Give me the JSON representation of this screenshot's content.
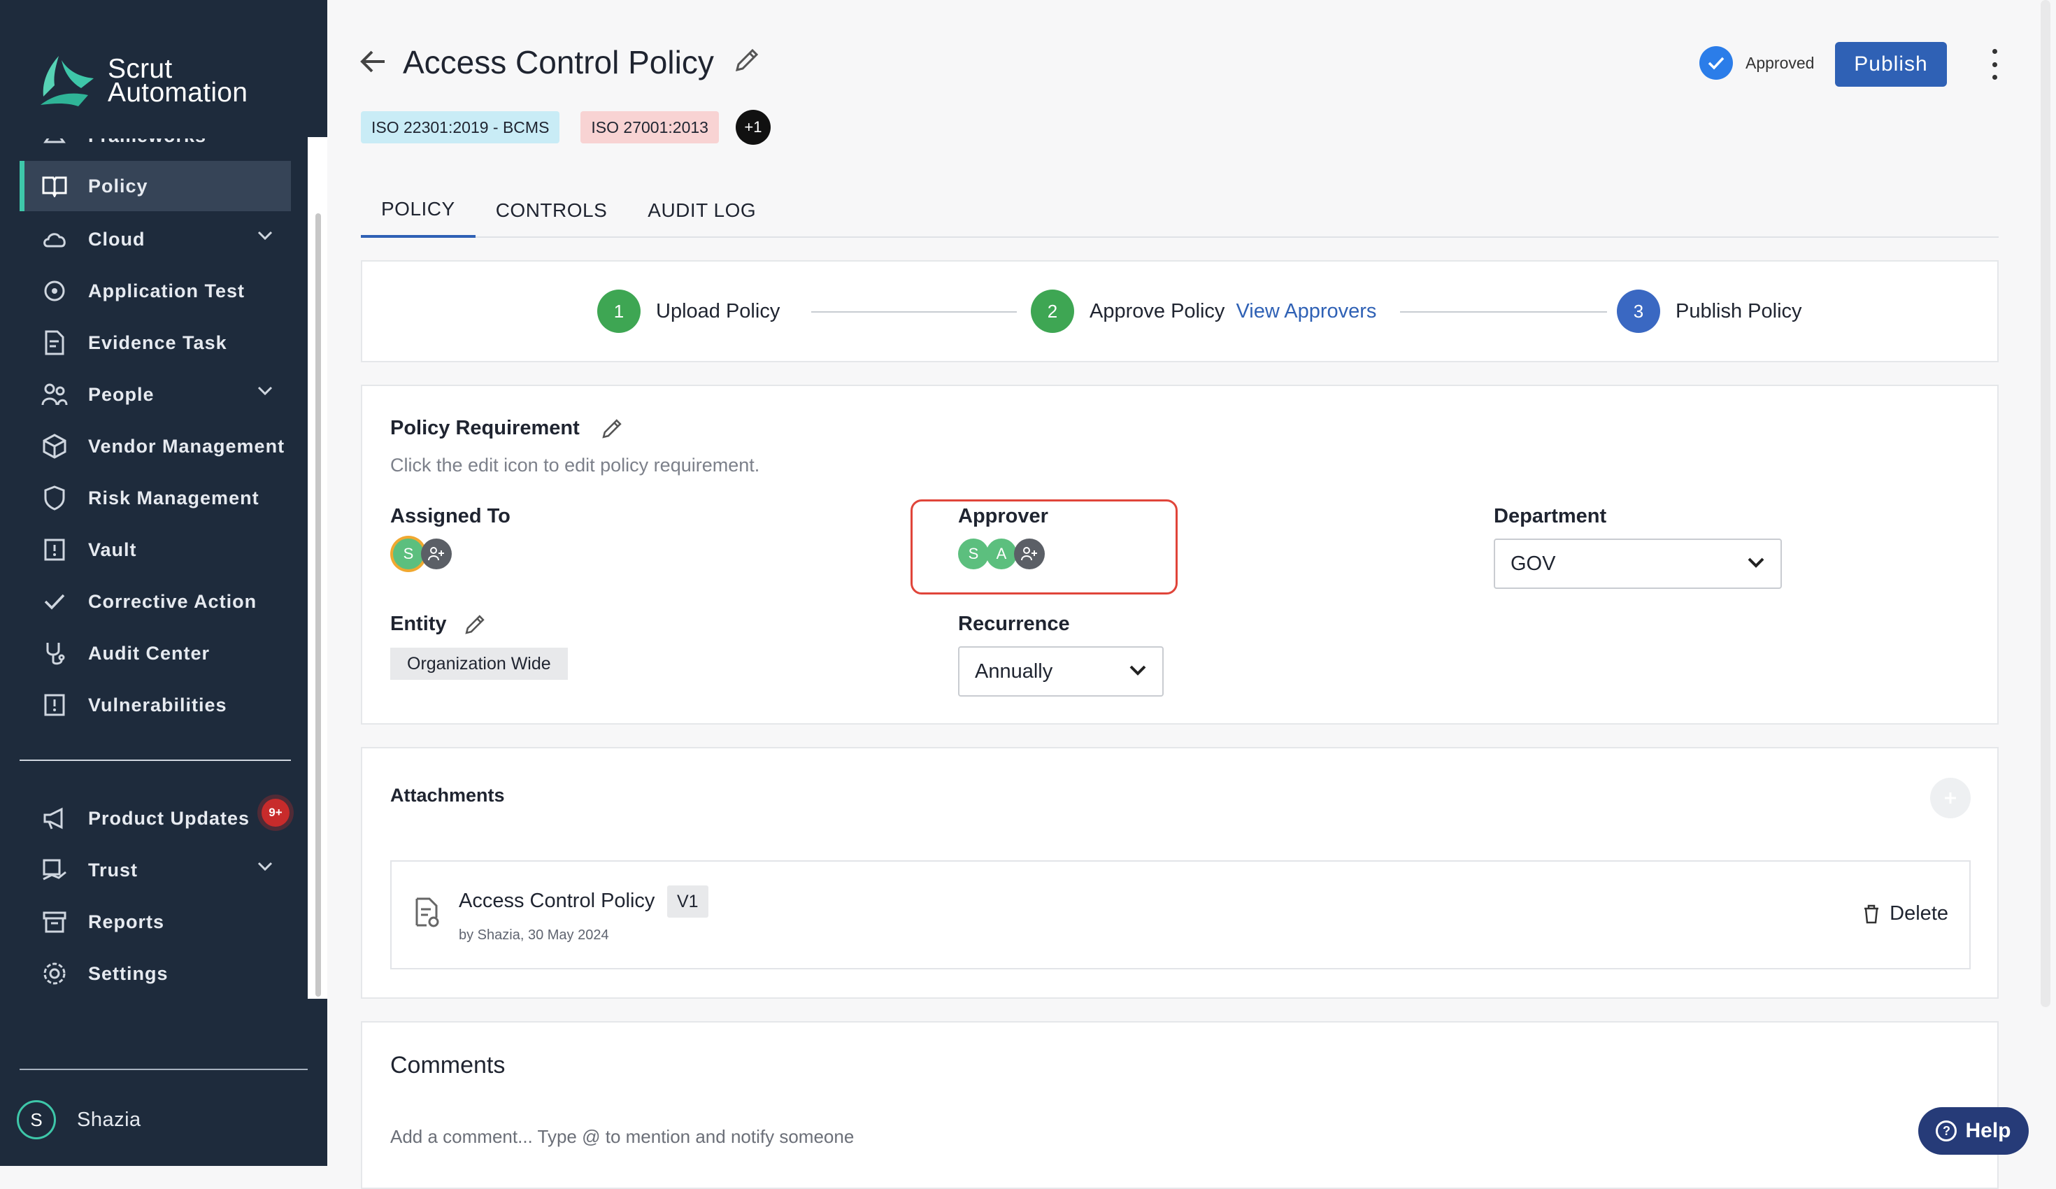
{
  "brand": {
    "line1": "Scrut",
    "line2": "Automation",
    "accent": "#3ec7a9"
  },
  "sidebar": {
    "items": [
      {
        "label": "Frameworks",
        "icon": "frameworks-icon"
      },
      {
        "label": "Policy",
        "icon": "book-icon",
        "active": true
      },
      {
        "label": "Cloud",
        "icon": "cloud-icon",
        "has_children": true
      },
      {
        "label": "Application Test",
        "icon": "app-test-icon"
      },
      {
        "label": "Evidence Task",
        "icon": "evidence-icon"
      },
      {
        "label": "People",
        "icon": "people-icon",
        "has_children": true
      },
      {
        "label": "Vendor Management",
        "icon": "vendor-icon"
      },
      {
        "label": "Risk Management",
        "icon": "shield-icon"
      },
      {
        "label": "Vault",
        "icon": "vault-icon"
      },
      {
        "label": "Corrective Action",
        "icon": "check-icon"
      },
      {
        "label": "Audit Center",
        "icon": "audit-icon"
      },
      {
        "label": "Vulnerabilities",
        "icon": "alert-icon"
      }
    ],
    "bottom_items": [
      {
        "label": "Product Updates",
        "icon": "megaphone-icon",
        "badge": "9+"
      },
      {
        "label": "Trust",
        "icon": "trust-icon",
        "has_children": true
      },
      {
        "label": "Reports",
        "icon": "archive-icon"
      },
      {
        "label": "Settings",
        "icon": "gear-icon"
      }
    ],
    "user": {
      "initial": "S",
      "name": "Shazia"
    }
  },
  "header": {
    "title": "Access Control Policy",
    "tags": [
      "ISO 22301:2019 - BCMS",
      "ISO 27001:2013"
    ],
    "more_tags": "+1",
    "status": "Approved",
    "publish_label": "Publish"
  },
  "tabs": [
    "POLICY",
    "CONTROLS",
    "AUDIT LOG"
  ],
  "stepper": {
    "steps": [
      {
        "num": "1",
        "label": "Upload Policy",
        "state": "done"
      },
      {
        "num": "2",
        "label": "Approve Policy",
        "link": "View Approvers",
        "state": "done"
      },
      {
        "num": "3",
        "label": "Publish Policy",
        "state": "current"
      }
    ]
  },
  "requirement": {
    "title": "Policy Requirement",
    "hint": "Click the edit icon to edit policy requirement.",
    "assigned_label": "Assigned To",
    "assigned_avatars": [
      "S"
    ],
    "approver_label": "Approver",
    "approver_avatars": [
      "S",
      "A"
    ],
    "department_label": "Department",
    "department_value": "GOV",
    "entity_label": "Entity",
    "entity_value": "Organization Wide",
    "recurrence_label": "Recurrence",
    "recurrence_value": "Annually"
  },
  "attachments": {
    "title": "Attachments",
    "file": {
      "name": "Access Control Policy",
      "version": "V1",
      "meta": "by Shazia, 30 May 2024",
      "delete_label": "Delete"
    }
  },
  "comments": {
    "title": "Comments",
    "placeholder": "Add a comment... Type @ to mention and notify someone"
  },
  "help_label": "Help"
}
